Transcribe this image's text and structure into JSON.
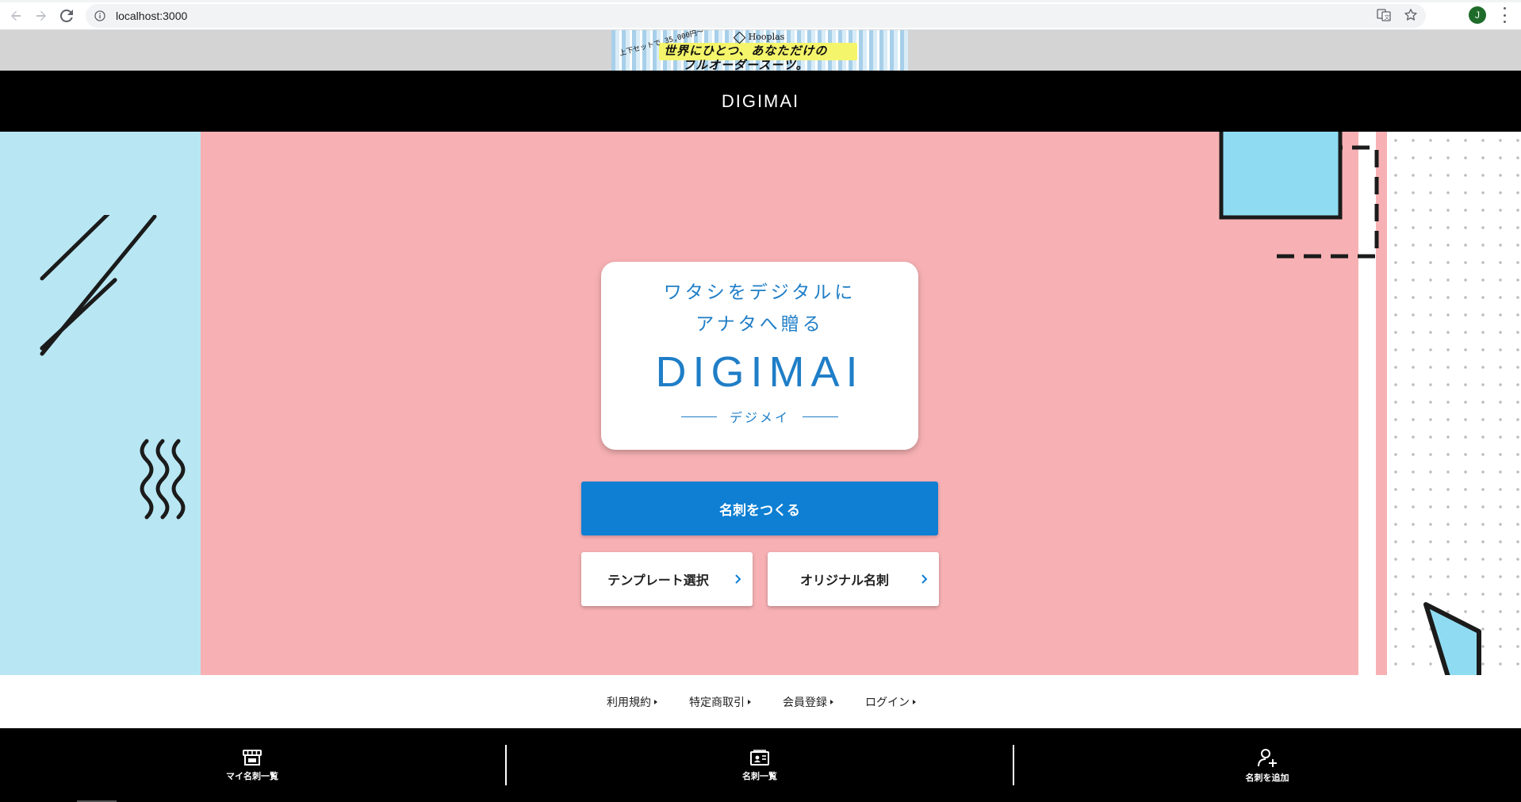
{
  "browser": {
    "url": "localhost:3000",
    "profile_initial": "J"
  },
  "ad": {
    "brand": "Hooplas",
    "small_text": "上下セットで 35,000円〜",
    "line1": "世界にひとつ、あなただけの",
    "line2": "フルオーダースーツ。"
  },
  "header": {
    "title": "DIGIMAI"
  },
  "hero": {
    "tagline_line1": "ワタシをデジタルに",
    "tagline_line2": "アナタへ贈る",
    "logo": "DIGIMAI",
    "subtitle": "デジメイ",
    "primary_button": "名刺をつくる",
    "template_button": "テンプレート選択",
    "original_button": "オリジナル名刺"
  },
  "footer_links": [
    {
      "label": "利用規約"
    },
    {
      "label": "特定商取引"
    },
    {
      "label": "会員登録"
    },
    {
      "label": "ログイン"
    }
  ],
  "bottom_nav": [
    {
      "label": "マイ名刺一覧",
      "icon": "store-icon"
    },
    {
      "label": "名刺一覧",
      "icon": "card-list-icon"
    },
    {
      "label": "名刺を追加",
      "icon": "add-user-icon"
    }
  ],
  "colors": {
    "accent_blue": "#0e7fd3",
    "text_blue": "#1f7ec7",
    "hero_pink": "#f7b1b4",
    "hero_light_blue": "#b8e7f3",
    "header_black": "#000000"
  }
}
